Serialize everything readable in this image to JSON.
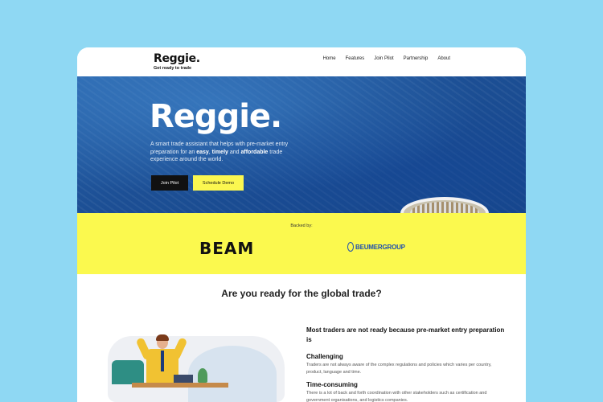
{
  "brand": {
    "name": "Reggie.",
    "tagline": "Get ready to trade"
  },
  "nav": [
    "Home",
    "Features",
    "Join Pilot",
    "Partnership",
    "About"
  ],
  "hero": {
    "title": "Reggie.",
    "desc_1": "A smart trade assistant that helps with pre-market entry preparation for an ",
    "em_1": "easy",
    "sep_1": ", ",
    "em_2": "timely",
    "sep_2": " and ",
    "em_3": "affordable",
    "desc_2": " trade experience around the world.",
    "btn_primary": "Join Pilot",
    "btn_secondary": "Schedule Demo"
  },
  "backers": {
    "label": "Backed by:",
    "logos": [
      "BEAM",
      "BEUMERGROUP"
    ]
  },
  "question": {
    "before": "Are you ready for the ",
    "bold": "global",
    "after": " trade?"
  },
  "section": {
    "heading": "Most traders are not ready because pre-market entry preparation is",
    "items": [
      {
        "title": "Challenging",
        "desc": "Traders are not always aware of the complex regulations and policies which varies per country, product, language and time."
      },
      {
        "title": "Time-consuming",
        "desc": "There is a lot of back and forth coordination with other stakeholders such as certification and government organisations, and logistics companies."
      }
    ]
  },
  "colors": {
    "background": "#8fd8f3",
    "accent": "#fbf94e",
    "ocean": "#1c4f95",
    "beumer": "#1c4db0"
  }
}
